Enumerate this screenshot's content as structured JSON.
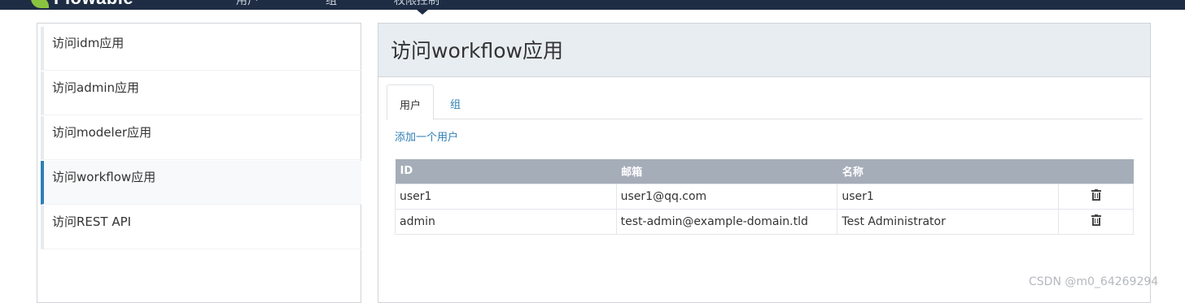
{
  "topbar": {
    "logo_text": "Flowable",
    "nav": [
      "用户",
      "组",
      "权限控制"
    ]
  },
  "sidebar": {
    "items": [
      {
        "label": "访问idm应用"
      },
      {
        "label": "访问admin应用"
      },
      {
        "label": "访问modeler应用"
      },
      {
        "label": "访问workflow应用"
      },
      {
        "label": "访问REST API"
      }
    ]
  },
  "main": {
    "title": "访问workflow应用",
    "tabs": [
      {
        "label": "用户"
      },
      {
        "label": "组"
      }
    ],
    "add_link": "添加一个用户",
    "table": {
      "headers": [
        "ID",
        "邮箱",
        "名称",
        ""
      ],
      "rows": [
        {
          "id": "user1",
          "email": "user1@qq.com",
          "name": "user1"
        },
        {
          "id": "admin",
          "email": "test-admin@example-domain.tld",
          "name": "Test Administrator"
        }
      ]
    }
  },
  "watermark": "CSDN @m0_64269294",
  "colors": {
    "topbar": "#1e2d44",
    "accent": "#2f7fb5",
    "table_header": "#a5adb8",
    "panel_header": "#e8edf1"
  }
}
